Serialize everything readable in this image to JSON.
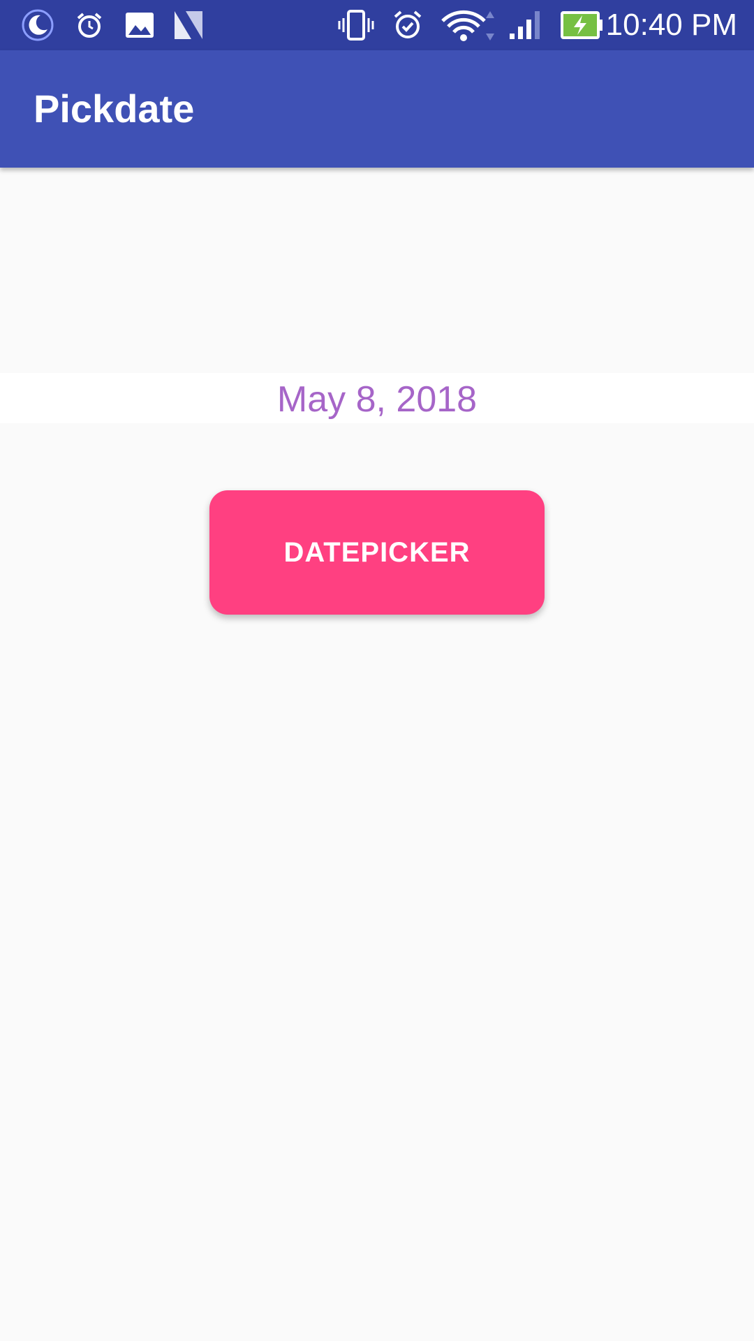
{
  "status_bar": {
    "time": "10:40 PM",
    "left_icons": [
      "moon-icon",
      "alarm-clock-icon",
      "image-icon",
      "n-logo-icon"
    ],
    "right_icons": [
      "vibrate-icon",
      "alarm-check-icon",
      "wifi-icon",
      "signal-icon",
      "battery-charging-icon"
    ],
    "background": "#303f9f"
  },
  "app_bar": {
    "title": "Pickdate",
    "background": "#3f51b5"
  },
  "main": {
    "date_text": "May 8, 2018",
    "date_color": "#a665c8",
    "datepicker_label": "DATEPICKER",
    "button_color": "#ff4081"
  }
}
